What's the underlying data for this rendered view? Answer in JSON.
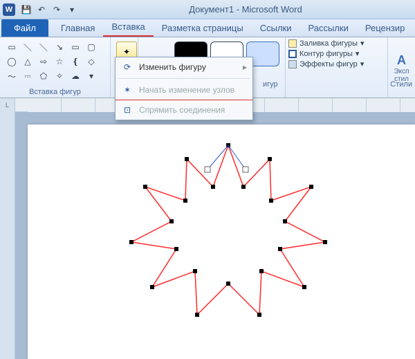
{
  "title": "Документ1 - Microsoft Word",
  "app_icon_letter": "W",
  "qat": {
    "save": "💾",
    "undo": "↶",
    "redo": "↷",
    "more": "▾"
  },
  "tabs": {
    "file": "Файл",
    "items": [
      "Главная",
      "Вставка",
      "Разметка страницы",
      "Ссылки",
      "Рассылки",
      "Рецензир"
    ]
  },
  "ribbon": {
    "shapes_group_label": "Вставка фигур",
    "styles_group_label": "игур",
    "styles_group_full": "Стили",
    "fill_label": "Заливка фигуры",
    "outline_label": "Контур фигуры",
    "effects_label": "Эффекты фигур",
    "express_top": "Эксп",
    "express_bot": "стил"
  },
  "dropdown": {
    "change_shape": "Изменить фигуру",
    "edit_points": "Начать изменение узлов",
    "straighten": "Спрямить соединения"
  },
  "ruler_corner": "L"
}
